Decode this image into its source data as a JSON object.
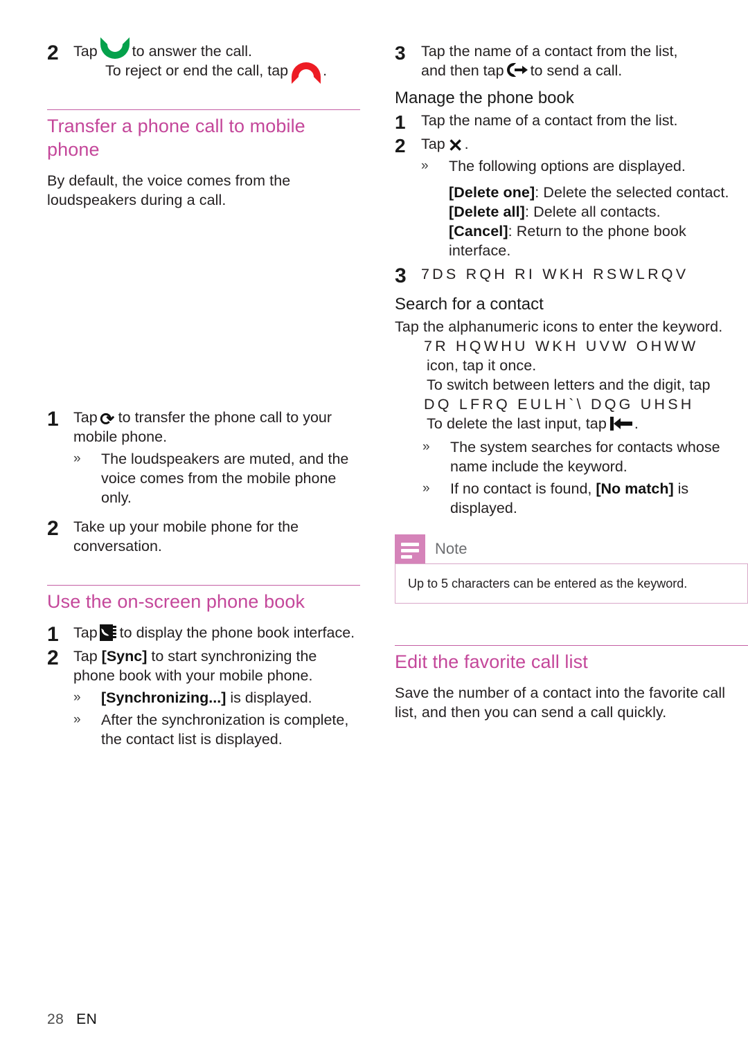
{
  "document": {
    "page_number": "28",
    "language": "EN",
    "accent_color": "#c4479a",
    "rule_color": "#c45ea4",
    "note_badge_color": "#d583b9",
    "answer_icon_color": "#04a14b",
    "reject_icon_color": "#ed1c24"
  },
  "left_column": {
    "step2": {
      "number": "2",
      "text_before_icon": "Tap",
      "answer_icon": "answer-call-icon",
      "text_after_icon": "to answer the call.",
      "line2_before_icon": "To reject or end the call, tap",
      "reject_icon": "reject-call-icon",
      "line2_after_icon": "."
    },
    "section_transfer": {
      "heading": "Transfer a phone call to mobile phone",
      "intro": "By default, the voice comes from the loudspeakers during a call.",
      "step1": {
        "number": "1",
        "text_before_icon": "Tap",
        "icon": "sync-transfer-icon",
        "text_after_icon": "to transfer the phone call to your mobile phone.",
        "bullet": "The loudspeakers are muted, and the voice comes from the mobile phone only."
      },
      "step2": {
        "number": "2",
        "text": "Take up your mobile phone for the conversation."
      }
    },
    "section_phonebook": {
      "heading": "Use the on-screen phone book",
      "step1": {
        "number": "1",
        "text_before_icon": "Tap",
        "icon": "phone-book-icon",
        "text_after_icon": "to display the phone book interface."
      },
      "step2": {
        "number": "2",
        "text_before_bold": "Tap",
        "bold": "[Sync]",
        "text_after_bold": "to start synchronizing the phone book with your mobile phone.",
        "bullet1_bold": "[Synchronizing...]",
        "bullet1_rest": "is displayed.",
        "bullet2": "After the synchronization is complete, the contact list is displayed."
      }
    }
  },
  "right_column": {
    "step3": {
      "number": "3",
      "line1": "Tap the name of a contact from the list,",
      "line2_before_icon": "and then tap",
      "icon": "send-call-icon",
      "line2_after_icon": "to send a call."
    },
    "manage_phone_book": {
      "heading": "Manage the phone book",
      "step1": {
        "number": "1",
        "text": "Tap the name of a contact from the list."
      },
      "step2": {
        "number": "2",
        "text_before_icon": "Tap",
        "icon": "delete-x-icon",
        "text_after_icon": ".",
        "bullet": "The following options are displayed."
      },
      "options": [
        {
          "label": "[Delete one]",
          "description": ": Delete the selected contact."
        },
        {
          "label": "[Delete all]",
          "description": ": Delete all contacts."
        },
        {
          "label": "[Cancel]",
          "description": ": Return to the phone book interface."
        }
      ],
      "step3_garbled": {
        "number": "3",
        "text": "7DS RQH RI WKH RSWLRQV"
      }
    },
    "search_contact": {
      "heading": "Search for a contact",
      "intro": "Tap the alphanumeric icons to enter the keyword.",
      "garbled_line1": "7R HQWHU WKH UVW OHWW",
      "line_after_garbled1": "icon, tap it once.",
      "line_switch": "To switch between letters and the digit, tap",
      "garbled_line2": "DQ LFRQ EULH`\\ DQG UHSH",
      "line_delete_before_icon": "To delete the last input, tap",
      "backspace_icon": "backspace-icon",
      "line_delete_after_icon": ".",
      "bullet1": "The system searches for contacts whose name include the keyword.",
      "bullet2_before_bold": "If no contact is found,",
      "bullet2_bold": "[No match]",
      "bullet2_after_bold": "is displayed."
    },
    "note": {
      "icon": "note-lines-icon",
      "title": "Note",
      "body": "Up to 5 characters can be entered as the keyword."
    },
    "section_favorite": {
      "heading": "Edit the favorite call list",
      "body": "Save the number of a contact into the favorite call list, and then you can send a call quickly."
    }
  }
}
